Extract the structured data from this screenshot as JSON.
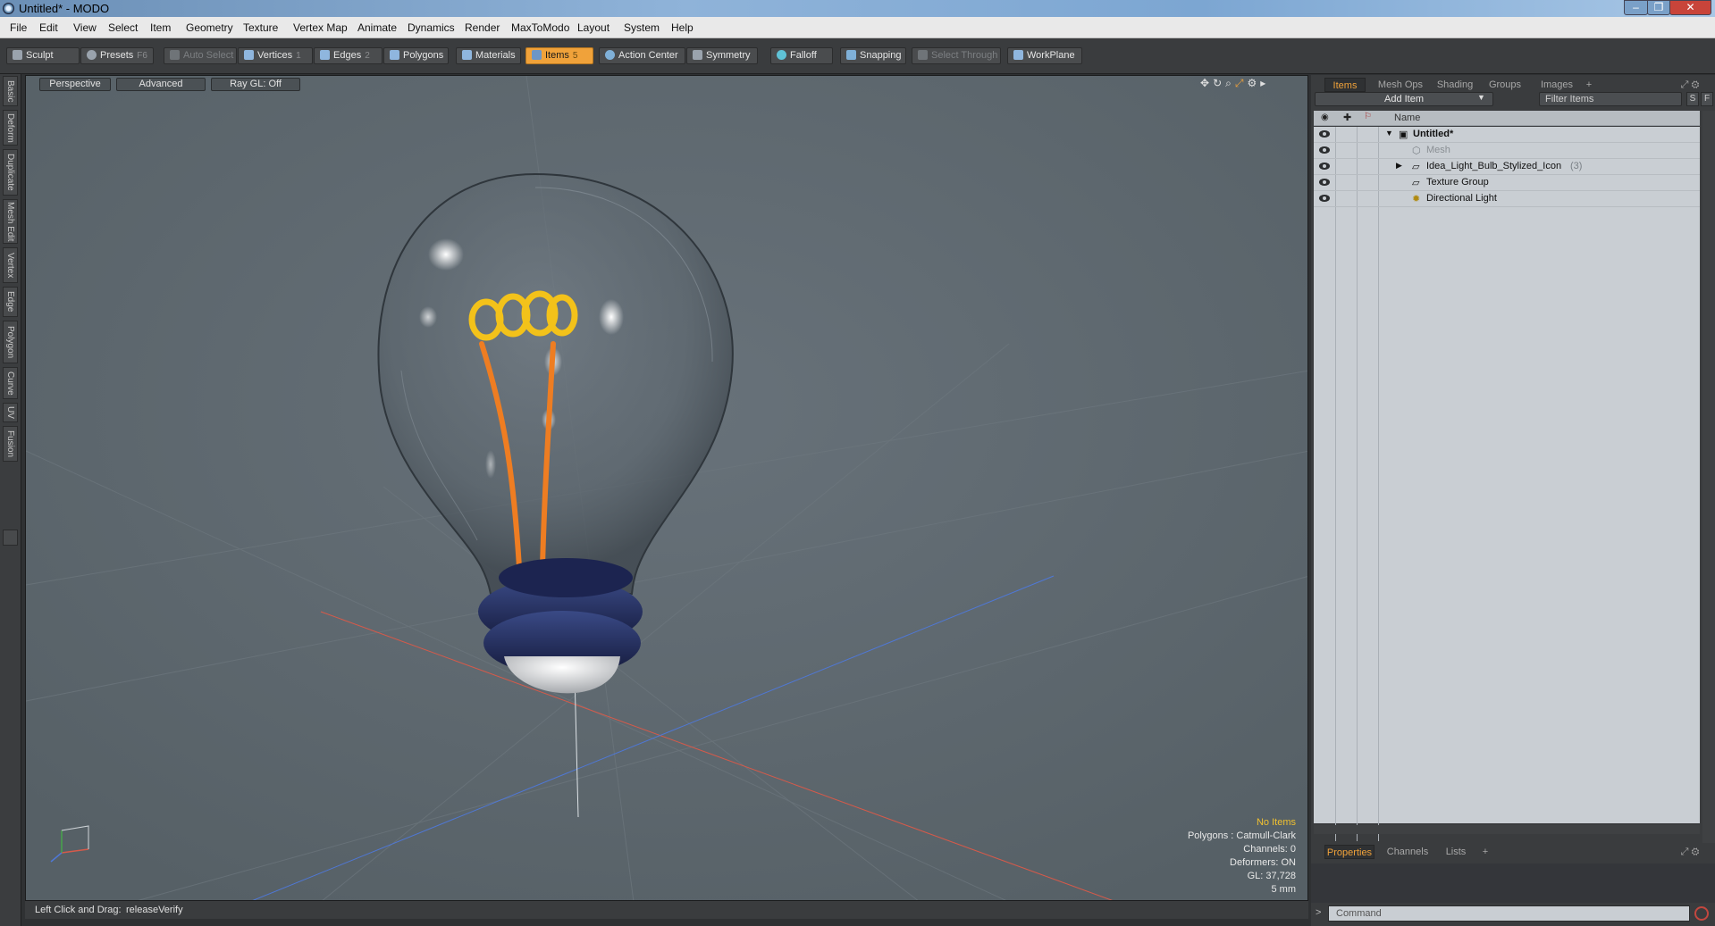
{
  "window": {
    "title": "Untitled* - MODO"
  },
  "menu": [
    "File",
    "Edit",
    "View",
    "Select",
    "Item",
    "Geometry",
    "Texture",
    "Vertex Map",
    "Animate",
    "Dynamics",
    "Render",
    "MaxToModo",
    "Layout",
    "System",
    "Help"
  ],
  "toolbar": {
    "sculpt": "Sculpt",
    "presets": "Presets",
    "presets_hotkey": "F6",
    "auto_select": "Auto Select",
    "vertices": "Vertices",
    "vertices_hotkey": "1",
    "edges": "Edges",
    "edges_hotkey": "2",
    "polygons": "Polygons",
    "materials": "Materials",
    "items": "Items",
    "items_hotkey": "5",
    "action_center": "Action Center",
    "symmetry": "Symmetry",
    "falloff": "Falloff",
    "snapping": "Snapping",
    "select_through": "Select Through",
    "workplane": "WorkPlane"
  },
  "left_tabs": [
    "Basic",
    "Deform",
    "Duplicate",
    "Mesh Edit",
    "Vertex",
    "Edge",
    "Polygon",
    "Curve",
    "UV",
    "Fusion"
  ],
  "viewport": {
    "view_mode": "Perspective",
    "shading": "Advanced",
    "raygl": "Ray GL: Off",
    "hud": {
      "selection": "No Items",
      "polygons": "Polygons : Catmull-Clark",
      "channels": "Channels: 0",
      "deformers": "Deformers: ON",
      "gl": "GL: 37,728",
      "scale": "5 mm"
    }
  },
  "status": {
    "hint": "Left Click and Drag:",
    "action": "releaseVerify"
  },
  "items_panel": {
    "tabs": [
      "Items",
      "Mesh Ops",
      "Shading",
      "Groups",
      "Images"
    ],
    "add_item": "Add Item",
    "filter_placeholder": "Filter Items",
    "filter_s": "S",
    "filter_f": "F",
    "column_name": "Name",
    "tree": [
      {
        "label": "Untitled*",
        "count": ""
      },
      {
        "label": "Mesh",
        "count": ""
      },
      {
        "label": "Idea_Light_Bulb_Stylized_Icon",
        "count": "(3)"
      },
      {
        "label": "Texture Group",
        "count": ""
      },
      {
        "label": "Directional Light",
        "count": ""
      }
    ]
  },
  "properties_panel": {
    "tabs": [
      "Properties",
      "Channels",
      "Lists"
    ],
    "command_placeholder": "Command"
  },
  "colors": {
    "accent": "#f0a23a",
    "viewport_bg": "#5e676d",
    "bulb_base": "#1f2a55",
    "filament": "#f0b81a"
  }
}
